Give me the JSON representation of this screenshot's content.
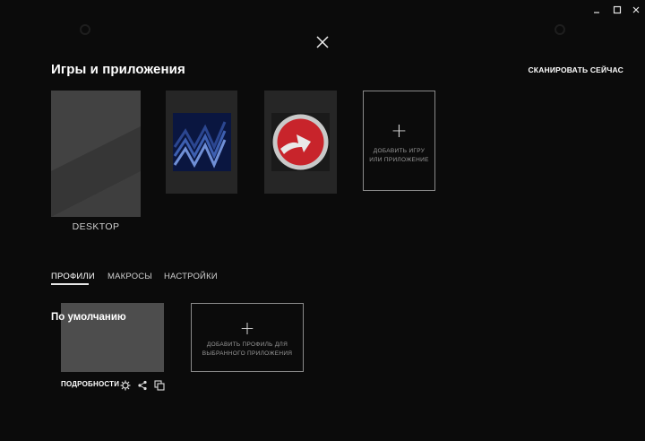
{
  "window": {
    "minimize_icon": "minimize-icon",
    "maximize_icon": "maximize-icon",
    "close_icon": "close-icon"
  },
  "overlay": {
    "close_icon": "close-x-icon",
    "title": "Игры и приложения",
    "scan_label": "СКАНИРОВАТЬ СЕЙЧАС"
  },
  "games": [
    {
      "name": "DESKTOP",
      "icon": "desktop-tile"
    },
    {
      "name": "",
      "icon": "blue-stripes-game-icon"
    },
    {
      "name": "",
      "icon": "red-arrow-game-icon"
    }
  ],
  "add_game": {
    "icon": "plus-icon",
    "label": "ДОБАВИТЬ ИГРУ\nИЛИ ПРИЛОЖЕНИЕ"
  },
  "tabs": [
    {
      "label": "ПРОФИЛИ",
      "active": true
    },
    {
      "label": "МАКРОСЫ",
      "active": false
    },
    {
      "label": "НАСТРОЙКИ",
      "active": false
    }
  ],
  "profile": {
    "name": "По умолчанию",
    "details_label": "ПОДРОБНОСТИ",
    "icons": [
      "gear-icon",
      "share-icon",
      "copy-icon"
    ]
  },
  "add_profile": {
    "icon": "plus-icon",
    "label": "ДОБАВИТЬ ПРОФИЛЬ ДЛЯ\nВЫБРАННОГО ПРИЛОЖЕНИЯ"
  },
  "colors": {
    "background": "#0b0b0b",
    "accent_red": "#c8242b",
    "card": "#262626"
  }
}
